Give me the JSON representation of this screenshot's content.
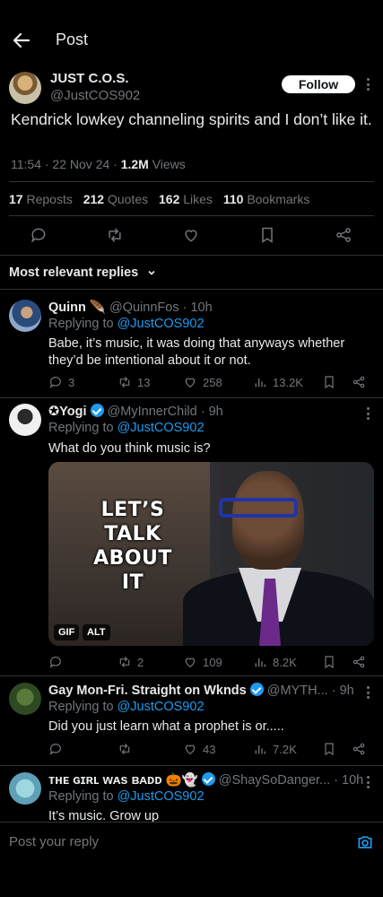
{
  "header": {
    "title": "Post"
  },
  "post": {
    "author_name": "JUST C.O.S.",
    "author_handle": "@JustCOS902",
    "follow_label": "Follow",
    "text": "Kendrick lowkey channeling spirits and I don’t like it.",
    "time": "11:54 · 22 Nov 24 · ",
    "views_count": "1.2M",
    "views_label": " Views",
    "stats": {
      "reposts_count": "17",
      "reposts_label": "Reposts",
      "quotes_count": "212",
      "quotes_label": "Quotes",
      "likes_count": "162",
      "likes_label": "Likes",
      "bookmarks_count": "110",
      "bookmarks_label": "Bookmarks"
    }
  },
  "replies_sort_label": "Most relevant replies",
  "replies": [
    {
      "name": "Quinn 🪶",
      "handle_time": "@QuinnFos · 10h",
      "replying_prefix": "Replying to ",
      "replying_handle": "@JustCOS902",
      "text": "Babe, it’s music, it was doing that anyways whether they’d be intentional about it or not.",
      "replies": "3",
      "reposts": "13",
      "likes": "258",
      "views": "13.2K"
    },
    {
      "name": "✪Yogi",
      "handle_time": "@MyInnerChild · 9h",
      "replying_prefix": "Replying to ",
      "replying_handle": "@JustCOS902",
      "text": "What do you think music is?",
      "media_text": "LET’S TALK ABOUT IT",
      "media_tags": [
        "GIF",
        "ALT"
      ],
      "replies": "",
      "reposts": "2",
      "likes": "109",
      "views": "8.2K"
    },
    {
      "name": "Gay Mon-Fri. Straight on Wknds",
      "handle_time": "@MYTH...",
      "time": " · 9h",
      "replying_prefix": "Replying to ",
      "replying_handle": "@JustCOS902",
      "text": "Did you just learn what a prophet is or.....",
      "replies": "",
      "reposts": "",
      "likes": "43",
      "views": "7.2K"
    },
    {
      "name": "ᴛʜᴇ ɢɪʀʟ ᴡᴀs ʙᴀᴅᴅ 🎃👻",
      "handle_time": "@ShaySoDanger...",
      "time": " · 10h",
      "replying_prefix": "Replying to ",
      "replying_handle": "@JustCOS902",
      "text": "It’s music. Grow up"
    }
  ],
  "composer": {
    "placeholder": "Post your reply"
  },
  "colors": {
    "accent": "#1d9bf0",
    "background": "#000000",
    "muted": "#71767b",
    "divider": "#2f3336"
  },
  "icons": [
    "back-arrow-icon",
    "more-icon",
    "reply-icon",
    "repost-icon",
    "like-icon",
    "bookmark-icon",
    "share-icon",
    "views-icon",
    "verified-icon",
    "chevron-down-icon",
    "camera-icon"
  ]
}
